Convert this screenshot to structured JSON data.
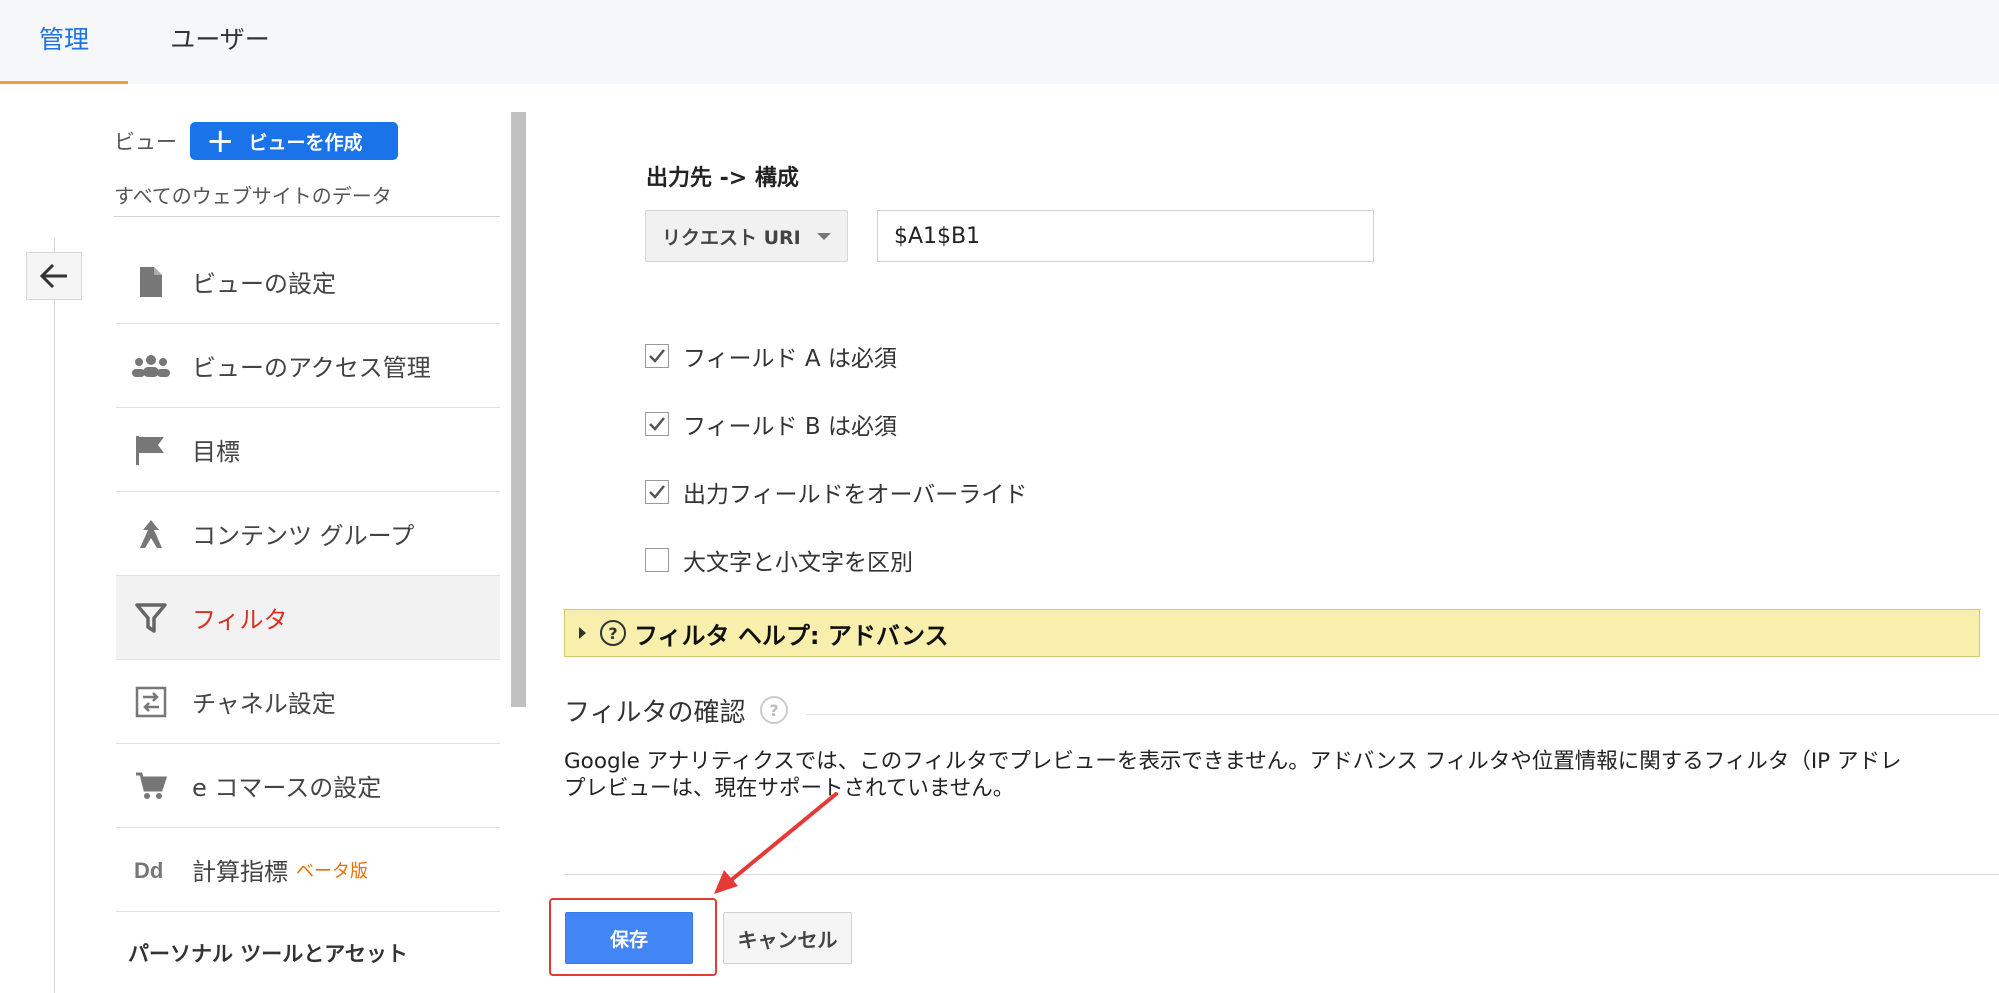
{
  "tabs": {
    "admin": "管理",
    "user": "ユーザー"
  },
  "sidebar": {
    "view_label": "ビュー",
    "create_view": "ビューを作成",
    "all_data": "すべてのウェブサイトのデータ",
    "items": [
      {
        "label": "ビューの設定",
        "icon": "document-icon"
      },
      {
        "label": "ビューのアクセス管理",
        "icon": "people-icon"
      },
      {
        "label": "目標",
        "icon": "flag-icon"
      },
      {
        "label": "コンテンツ グループ",
        "icon": "content-group-icon"
      },
      {
        "label": "フィルタ",
        "icon": "filter-icon",
        "active": true
      },
      {
        "label": "チャネル設定",
        "icon": "channel-settings-icon"
      },
      {
        "label": "e コマースの設定",
        "icon": "cart-icon"
      },
      {
        "label": "計算指標",
        "badge": "ベータ版",
        "icon": "dd-icon"
      }
    ],
    "section_title": "パーソナル ツールとアセット"
  },
  "form": {
    "output_label": "出力先 -> 構成",
    "select_value": "リクエスト URI",
    "input_value": "$A1$B1",
    "checks": [
      {
        "label": "フィールド A は必須",
        "checked": true
      },
      {
        "label": "フィールド B は必須",
        "checked": true
      },
      {
        "label": "出力フィールドをオーバーライド",
        "checked": true
      },
      {
        "label": "大文字と小文字を区別",
        "checked": false
      }
    ],
    "help_label": "フィルタ ヘルプ: アドバンス",
    "verify_title": "フィルタの確認",
    "desc_line1": "Google アナリティクスでは、このフィルタでプレビューを表示できません。アドバンス フィルタや位置情報に関するフィルタ（IP アドレ",
    "desc_line2": "プレビューは、現在サポートされていません。",
    "save": "保存",
    "cancel": "キャンセル"
  },
  "colors": {
    "accent": "#1a73e8",
    "active_text": "#d93025",
    "tab_underline": "#f29c38",
    "help_bg": "#f8efad",
    "save_bg": "#4285f4",
    "annotation": "#e53935"
  }
}
